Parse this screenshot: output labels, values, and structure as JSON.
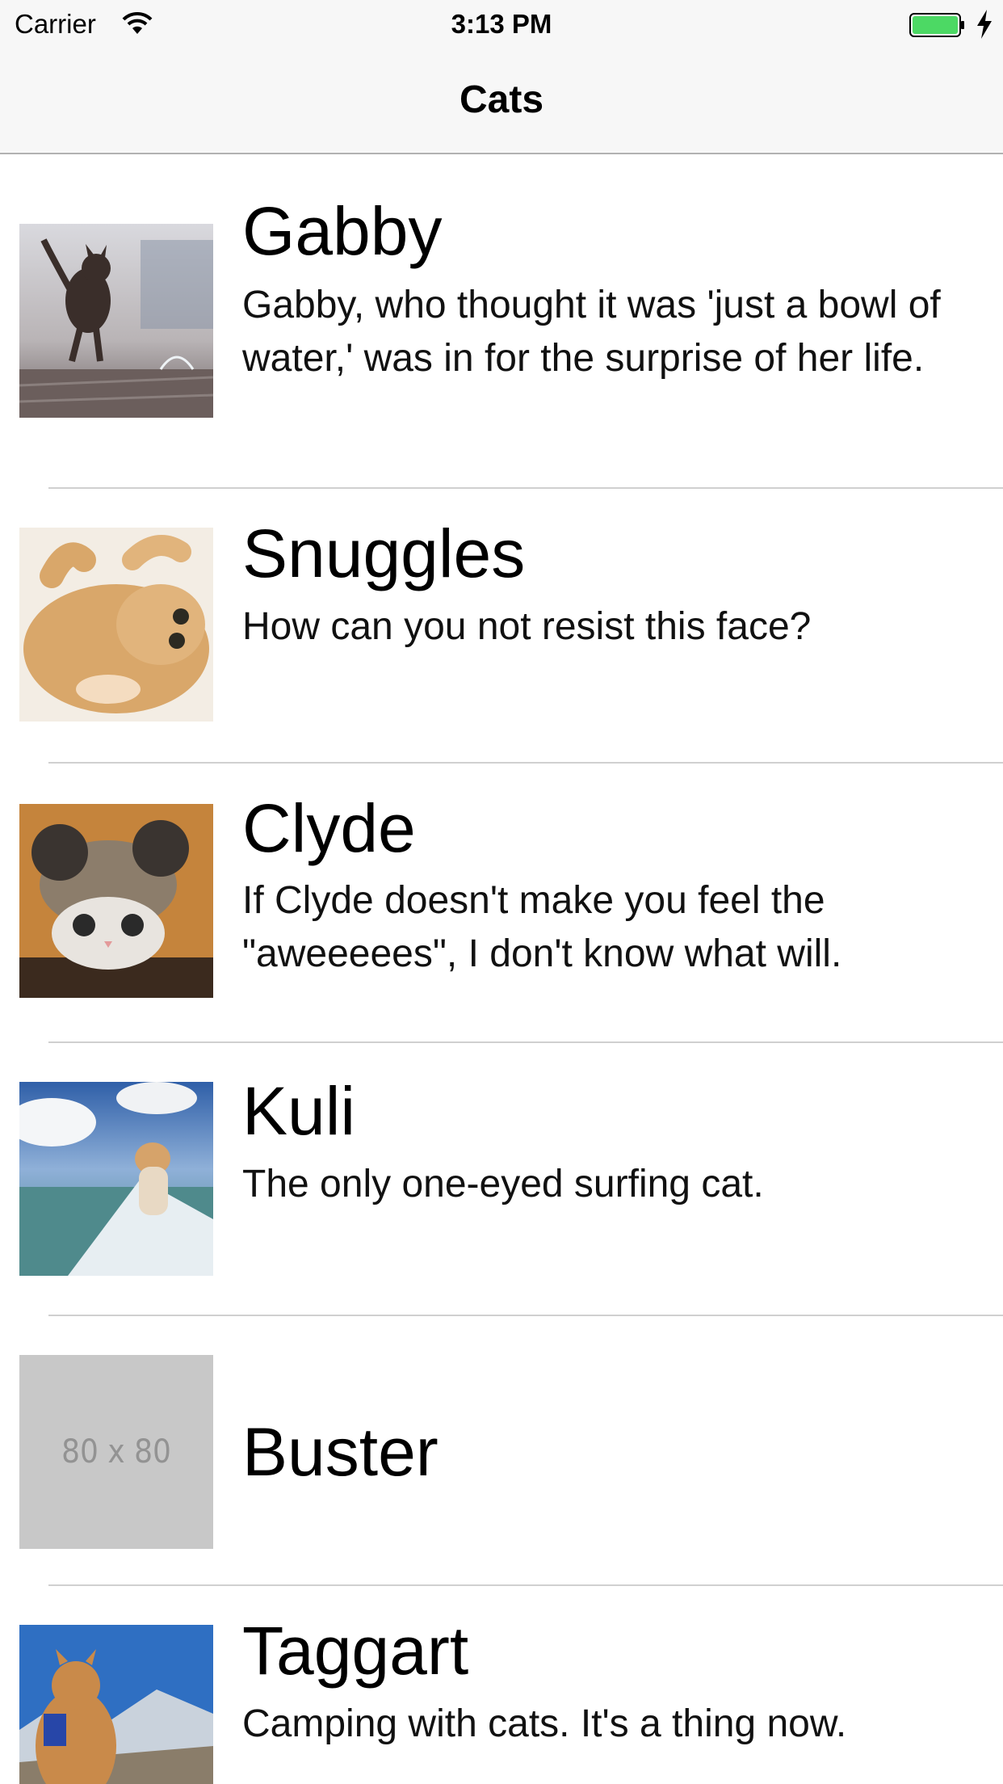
{
  "status_bar": {
    "carrier": "Carrier",
    "time": "3:13 PM",
    "battery_color": "#4cd964"
  },
  "nav": {
    "title": "Cats"
  },
  "cats": [
    {
      "name": "Gabby",
      "description": "Gabby, who thought it was 'just a bowl of water,' was in for the surprise of her life.",
      "image": "cat-jumping-photo"
    },
    {
      "name": "Snuggles",
      "description": "How can you not resist this face?",
      "image": "kitten-on-back-photo"
    },
    {
      "name": "Clyde",
      "description": "If Clyde doesn't make you feel the \"aweeeees\", I don't know what will.",
      "image": "cat-in-bear-hat-photo"
    },
    {
      "name": "Kuli",
      "description": "The only one-eyed surfing cat.",
      "image": "surfing-cat-photo"
    },
    {
      "name": "Buster",
      "description": "",
      "image": "placeholder",
      "placeholder_label": "80 x 80"
    },
    {
      "name": "Taggart",
      "description": "Camping with cats. It's a thing now.",
      "image": "camping-cat-photo"
    }
  ]
}
